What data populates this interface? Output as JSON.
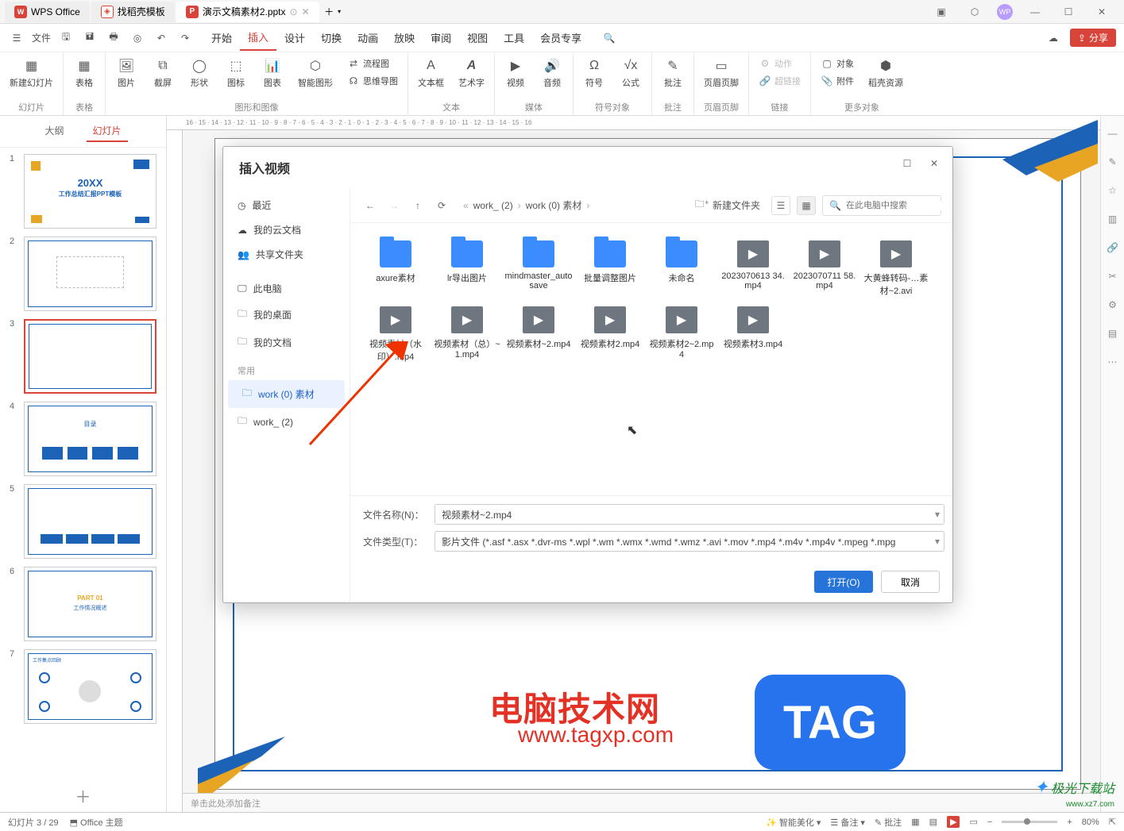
{
  "titlebar": {
    "app_name": "WPS Office",
    "template_tab": "找稻壳模板",
    "file_tab": "演示文稿素材2.pptx"
  },
  "quicktools": {
    "file_menu": "文件"
  },
  "menu": {
    "start": "开始",
    "insert": "插入",
    "design": "设计",
    "transition": "切换",
    "animation": "动画",
    "slideshow": "放映",
    "review": "审阅",
    "view": "视图",
    "tools": "工具",
    "member": "会员专享"
  },
  "share_button": "分享",
  "ribbon": {
    "new_slide": "新建幻灯片",
    "table": "表格",
    "picture": "图片",
    "screenshot": "截屏",
    "shape": "形状",
    "icon": "图标",
    "chart": "图表",
    "smartart": "智能图形",
    "flowchart": "流程图",
    "mindmap": "思维导图",
    "textbox": "文本框",
    "wordart": "艺术字",
    "video": "视频",
    "audio": "音频",
    "symbol": "符号",
    "equation": "公式",
    "comment": "批注",
    "header_footer": "页眉页脚",
    "action": "动作",
    "hyperlink": "超链接",
    "object": "对象",
    "attachment": "附件",
    "resource": "稻壳资源",
    "more_objects": "更多对象",
    "g_slide": "幻灯片",
    "g_table": "表格",
    "g_image": "图形和图像",
    "g_text": "文本",
    "g_media": "媒体",
    "g_symbol": "符号对象",
    "g_comment": "批注",
    "g_hf": "页眉页脚",
    "g_link": "链接"
  },
  "slide_panel": {
    "outline": "大纲",
    "slides": "幻灯片"
  },
  "thumbs": {
    "t1_year": "20XX",
    "t1_title": "工作总结汇报PPT模板",
    "t4_text": "目录",
    "t6_part": "PART 01",
    "t6_sub": "工作情况概述",
    "t7_text": "工作集点回顾"
  },
  "notes_placeholder": "单击此处添加备注",
  "dialog": {
    "title": "插入视频",
    "side": {
      "recent": "最近",
      "cloud": "我的云文档",
      "shared": "共享文件夹",
      "this_pc": "此电脑",
      "desktop": "我的桌面",
      "documents": "我的文档",
      "freq_label": "常用",
      "work_material": "work (0) 素材",
      "work_dir": "work_ (2)"
    },
    "breadcrumb": {
      "p1": "work_ (2)",
      "p2": "work (0) 素材"
    },
    "new_folder": "新建文件夹",
    "search_placeholder": "在此电脑中搜索",
    "files": [
      {
        "type": "folder",
        "name": "axure素材"
      },
      {
        "type": "folder",
        "name": "lr导出图片"
      },
      {
        "type": "folder",
        "name": "mindmaster_autosave"
      },
      {
        "type": "folder",
        "name": "批量调整图片"
      },
      {
        "type": "folder",
        "name": "未命名"
      },
      {
        "type": "video",
        "name": "2023070613 34.mp4"
      },
      {
        "type": "video",
        "name": "2023070711 58.mp4"
      },
      {
        "type": "video",
        "name": "大黄蜂转码-…素材~2.avi"
      },
      {
        "type": "video",
        "name": "视频素材（水印）.mp4"
      },
      {
        "type": "video",
        "name": "视频素材（总）~1.mp4"
      },
      {
        "type": "video",
        "name": "视频素材~2.mp4"
      },
      {
        "type": "video",
        "name": "视频素材2.mp4"
      },
      {
        "type": "video",
        "name": "视频素材2~2.mp4"
      },
      {
        "type": "video",
        "name": "视频素材3.mp4"
      }
    ],
    "filename_label": "文件名称(N)：",
    "filename_value": "视频素材~2.mp4",
    "filetype_label": "文件类型(T)：",
    "filetype_value": "影片文件 (*.asf *.asx *.dvr-ms *.wpl *.wm *.wmx *.wmd *.wmz *.avi *.mov *.mp4 *.m4v *.mp4v *.mpeg *.mpg",
    "open_btn": "打开(O)",
    "cancel_btn": "取消"
  },
  "statusbar": {
    "slide_counter": "幻灯片 3 / 29",
    "theme": "Office 主题",
    "beautify": "智能美化",
    "notes": "备注",
    "comments": "批注",
    "zoom": "80%"
  },
  "watermark": {
    "text1": "电脑技术网",
    "text2": "www.tagxp.com",
    "tag": "TAG",
    "jg": "极光下载站",
    "jg_url": "www.xz7.com"
  }
}
